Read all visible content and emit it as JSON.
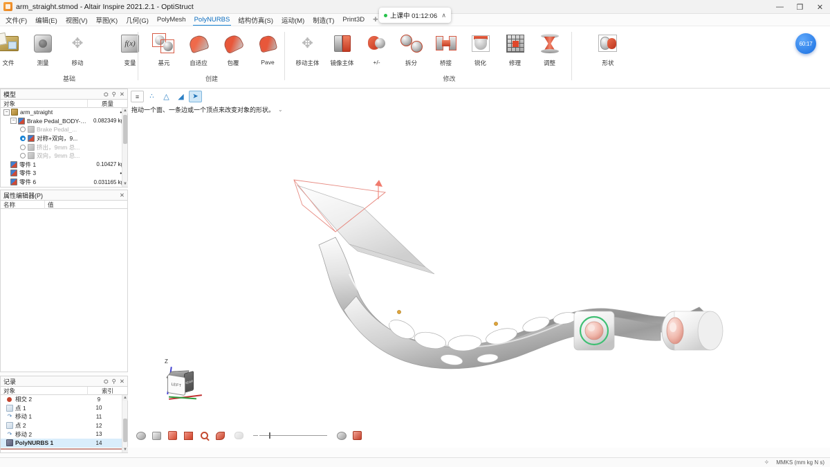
{
  "window": {
    "title": "arm_straight.stmod - Altair Inspire 2021.2.1 - OptiStruct",
    "app_icon": "altair-inspire-icon",
    "minimize": "—",
    "restore": "❐",
    "close": "✕"
  },
  "recording_pill": {
    "status_text": "上课中 01:12:06",
    "chevron": "∧"
  },
  "timer_bubble": {
    "value": "60:17"
  },
  "menubar": {
    "items": [
      {
        "label": "文件(F)",
        "active": false
      },
      {
        "label": "编辑(E)",
        "active": false
      },
      {
        "label": "视图(V)",
        "active": false
      },
      {
        "label": "草图(K)",
        "active": false
      },
      {
        "label": "几何(G)",
        "active": false
      },
      {
        "label": "PolyMesh",
        "active": false
      },
      {
        "label": "PolyNURBS",
        "active": true
      },
      {
        "label": "结构仿真(S)",
        "active": false
      },
      {
        "label": "运动(M)",
        "active": false
      },
      {
        "label": "制造(T)",
        "active": false
      },
      {
        "label": "Print3D",
        "active": false
      }
    ],
    "plus": "✚"
  },
  "ribbon": {
    "groups": [
      {
        "label": "基础",
        "items": [
          {
            "label": "文件",
            "icon": "file-icon"
          },
          {
            "label": "测量",
            "icon": "measure-icon"
          },
          {
            "label": "移动",
            "icon": "move-icon"
          },
          {
            "label": "变量",
            "icon": "variable-icon"
          }
        ]
      },
      {
        "label": "创建",
        "items": [
          {
            "label": "基元",
            "icon": "primitive-icon"
          },
          {
            "label": "自适应",
            "icon": "adaptive-icon"
          },
          {
            "label": "包覆",
            "icon": "wrap-icon"
          },
          {
            "label": "Pave",
            "icon": "pave-icon"
          }
        ]
      },
      {
        "label": "修改",
        "items": [
          {
            "label": "移动主体",
            "icon": "move-body-icon"
          },
          {
            "label": "镜像主体",
            "icon": "mirror-body-icon"
          },
          {
            "label": "+/-",
            "icon": "add-remove-icon"
          },
          {
            "label": "拆分",
            "icon": "split-icon"
          },
          {
            "label": "桥接",
            "icon": "bridge-icon"
          },
          {
            "label": "锐化",
            "icon": "sharpen-icon"
          },
          {
            "label": "修理",
            "icon": "repair-icon"
          },
          {
            "label": "调整",
            "icon": "adjust-icon"
          }
        ]
      },
      {
        "label": "",
        "items": [
          {
            "label": "形状",
            "icon": "shape-icon"
          }
        ]
      }
    ]
  },
  "model_panel": {
    "title": "模型",
    "header_icons": [
      "filter-icon",
      "search-icon",
      "close-icon"
    ],
    "columns": {
      "object": "对象",
      "mass": "质量"
    },
    "rows": [
      {
        "label": "arm_straight",
        "value": "••",
        "icon": "assembly-icon",
        "indent": 0,
        "expander": "-",
        "kind": "group",
        "dim": false,
        "radio": "none",
        "selected": false
      },
      {
        "label": "Brake Pedal_BODY-4...",
        "value": "0.082349 kg",
        "icon": "part-icon",
        "indent": 1,
        "expander": "-",
        "kind": "part",
        "dim": false,
        "radio": "none",
        "selected": false
      },
      {
        "label": "Brake Pedal_...",
        "value": "",
        "icon": "gray-icon",
        "indent": 2,
        "expander": "",
        "kind": "feature",
        "dim": true,
        "radio": "off",
        "selected": false
      },
      {
        "label": "对称+双向，9...",
        "value": "",
        "icon": "part-icon",
        "indent": 2,
        "expander": "",
        "kind": "feature",
        "dim": false,
        "radio": "on",
        "selected": false
      },
      {
        "label": "挤出，9mm 总...",
        "value": "",
        "icon": "gray-icon",
        "indent": 2,
        "expander": "",
        "kind": "feature",
        "dim": true,
        "radio": "off",
        "selected": false
      },
      {
        "label": "双向，9mm 总...",
        "value": "",
        "icon": "gray-icon",
        "indent": 2,
        "expander": "",
        "kind": "feature",
        "dim": true,
        "radio": "off",
        "selected": false
      },
      {
        "label": "零件 1",
        "value": "0.10427 kg",
        "icon": "part-icon",
        "indent": 1,
        "expander": "",
        "kind": "part",
        "dim": false,
        "radio": "none",
        "selected": false
      },
      {
        "label": "零件 3",
        "value": "••",
        "icon": "part-icon",
        "indent": 1,
        "expander": "",
        "kind": "part",
        "dim": false,
        "radio": "none",
        "selected": false
      },
      {
        "label": "零件 6",
        "value": "0.031165 kg",
        "icon": "part-icon",
        "indent": 1,
        "expander": "",
        "kind": "part",
        "dim": false,
        "radio": "none",
        "selected": false
      }
    ]
  },
  "property_panel": {
    "title": "属性编辑器(P)",
    "close_icon": "close-icon",
    "columns": {
      "name": "名称",
      "value": "值"
    },
    "rows": []
  },
  "history_panel": {
    "title": "记录",
    "header_icons": [
      "filter-icon",
      "search-icon",
      "close-icon"
    ],
    "columns": {
      "object": "对象",
      "index": "索引"
    },
    "rows": [
      {
        "label": "相交 2",
        "index": "9",
        "icon": "intersect-icon",
        "selected": false
      },
      {
        "label": "点 1",
        "index": "10",
        "icon": "point-icon",
        "selected": false
      },
      {
        "label": "移动 1",
        "index": "11",
        "icon": "move-icon",
        "selected": false
      },
      {
        "label": "点 2",
        "index": "12",
        "icon": "point-icon",
        "selected": false
      },
      {
        "label": "移动 2",
        "index": "13",
        "icon": "move-icon",
        "selected": false
      },
      {
        "label": "PolyNURBS 1",
        "index": "14",
        "icon": "polynurbs-icon",
        "selected": true
      }
    ]
  },
  "viewport": {
    "toolbar": [
      {
        "name": "list-mode-icon",
        "glyph": "≡",
        "active": false,
        "boxed": true
      },
      {
        "name": "vertex-mode-icon",
        "glyph": "∴",
        "active": false,
        "boxed": false
      },
      {
        "name": "face-mode-icon",
        "glyph": "△",
        "active": false,
        "boxed": false
      },
      {
        "name": "edge-mode-icon",
        "glyph": "◢",
        "active": false,
        "boxed": false
      },
      {
        "name": "drag-mode-icon",
        "glyph": "➤",
        "active": true,
        "boxed": false
      }
    ],
    "hint": "拖动一个面、一条边或一个顶点来改变对象的形状。",
    "hint_chevron": "⌄",
    "bottom_tools": [
      {
        "name": "view-rotate-icon"
      },
      {
        "name": "view-pan-icon"
      },
      {
        "name": "view-axes-icon"
      },
      {
        "name": "view-fit-icon"
      },
      {
        "name": "zoom-icon"
      },
      {
        "name": "section-icon"
      },
      {
        "name": "transparency-icon"
      }
    ],
    "bottom_tools_right": [
      {
        "name": "render-icon"
      },
      {
        "name": "material-icon"
      }
    ],
    "viewcube": {
      "axis_z_label": "Z",
      "front_face": "LEFT",
      "side_face": "REAR"
    }
  },
  "statusbar": {
    "gear_icon": "settings-icon",
    "units": "MMKS (mm kg N s)"
  }
}
